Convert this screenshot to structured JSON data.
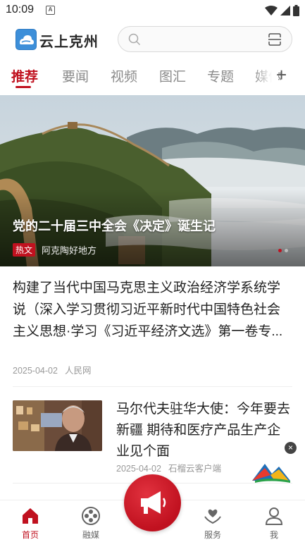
{
  "status_bar": {
    "time": "10:09",
    "notification_icon": "A"
  },
  "header": {
    "app_title": "云上克州",
    "search_placeholder": ""
  },
  "tabs": [
    {
      "label": "推荐",
      "active": true
    },
    {
      "label": "要闻",
      "active": false
    },
    {
      "label": "视频",
      "active": false
    },
    {
      "label": "图汇",
      "active": false
    },
    {
      "label": "专题",
      "active": false
    },
    {
      "label": "媒体",
      "active": false
    }
  ],
  "banner": {
    "title": "党的二十届三中全会《决定》诞生记",
    "tag": "热文",
    "source": "阿克陶好地方",
    "slide_count": 2,
    "active_slide": 1
  },
  "articles": [
    {
      "title": "构建了当代中国马克思主义政治经济学系统学说（深入学习贯彻习近平新时代中国特色社会主义思想·学习《习近平经济文选》第一卷专...",
      "date": "2025-04-02",
      "source": "人民网"
    },
    {
      "title": "马尔代夫驻华大使：今年要去新疆 期待和医疗产品生产企业见个面",
      "date": "2025-04-02",
      "source": "石榴云客户端"
    }
  ],
  "close_label": "×",
  "bottom_nav": [
    {
      "label": "首页",
      "icon": "home-icon",
      "active": true
    },
    {
      "label": "融媒",
      "icon": "film-reel-icon",
      "active": false
    },
    {
      "label": "",
      "icon": "megaphone-icon",
      "active": false
    },
    {
      "label": "服务",
      "icon": "heart-hand-icon",
      "active": false
    },
    {
      "label": "我",
      "icon": "person-icon",
      "active": false
    }
  ],
  "colors": {
    "accent": "#c0111f",
    "text": "#222222",
    "muted": "#999999"
  }
}
